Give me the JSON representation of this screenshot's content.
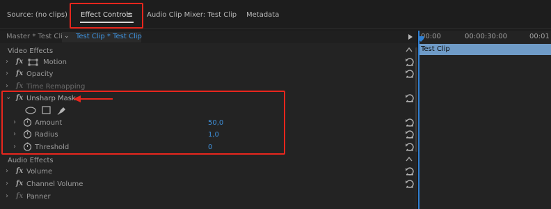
{
  "tabs": [
    {
      "label": "Source: (no clips)"
    },
    {
      "label": "Effect Controls"
    },
    {
      "label": "Audio Clip Mixer: Test Clip"
    },
    {
      "label": "Metadata"
    }
  ],
  "active_tab_menu_icon": "≡",
  "breadcrumb": {
    "master": "Master * Test Clip",
    "clip": "Test Clip * Test Clip"
  },
  "video_effects": {
    "title": "Video Effects",
    "rows": [
      {
        "label": "Motion",
        "icon": "motion-transform-icon"
      },
      {
        "label": "Opacity"
      },
      {
        "label": "Time Remapping"
      }
    ]
  },
  "unsharp_mask": {
    "label": "Unsharp Mask",
    "params": [
      {
        "label": "Amount",
        "value": "50,0"
      },
      {
        "label": "Radius",
        "value": "1,0"
      },
      {
        "label": "Threshold",
        "value": "0"
      }
    ]
  },
  "audio_effects": {
    "title": "Audio Effects",
    "rows": [
      {
        "label": "Volume"
      },
      {
        "label": "Channel Volume"
      },
      {
        "label": "Panner"
      }
    ]
  },
  "timeline": {
    "ticks": [
      "00:00",
      "00:00:30:00",
      "00:01"
    ],
    "clip_label": "Test Clip"
  },
  "colors": {
    "accent_blue": "#3f93df",
    "annotation_red": "#e8261d",
    "clip_bar": "#6f9bc7"
  }
}
